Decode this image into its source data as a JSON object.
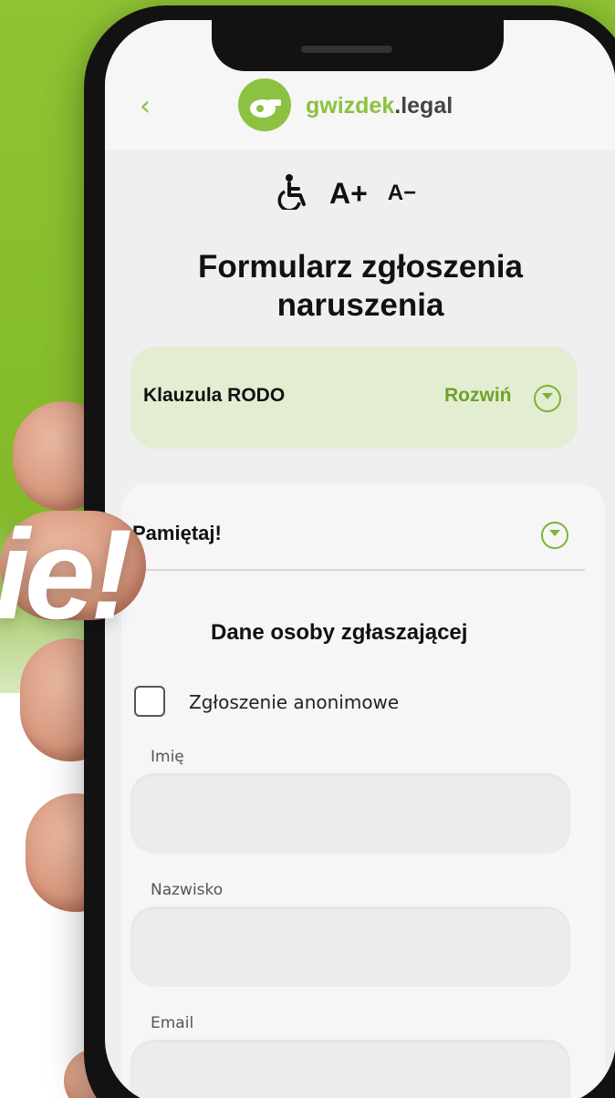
{
  "colors": {
    "brand": "#8cc142",
    "background": "#86bd2b"
  },
  "header": {
    "back_icon": "chevron-left-icon",
    "logo_brand": "gwizdek",
    "logo_suffix": ".legal"
  },
  "accessibility": {
    "icon": "wheelchair-icon",
    "increase": "A+",
    "decrease": "A−"
  },
  "page": {
    "title_line1": "Formularz zgłoszenia",
    "title_line2": "naruszenia"
  },
  "rodo": {
    "label": "Klauzula RODO",
    "expand": "Rozwiń"
  },
  "remember": {
    "label": "Pamiętaj!"
  },
  "form": {
    "section_title": "Dane osoby zgłaszającej",
    "anonymous_label": "Zgłoszenie anonimowe",
    "fields": [
      {
        "label": "Imię",
        "value": ""
      },
      {
        "label": "Nazwisko",
        "value": ""
      },
      {
        "label": "Email",
        "value": ""
      }
    ]
  },
  "promo": {
    "text": "ie!"
  }
}
